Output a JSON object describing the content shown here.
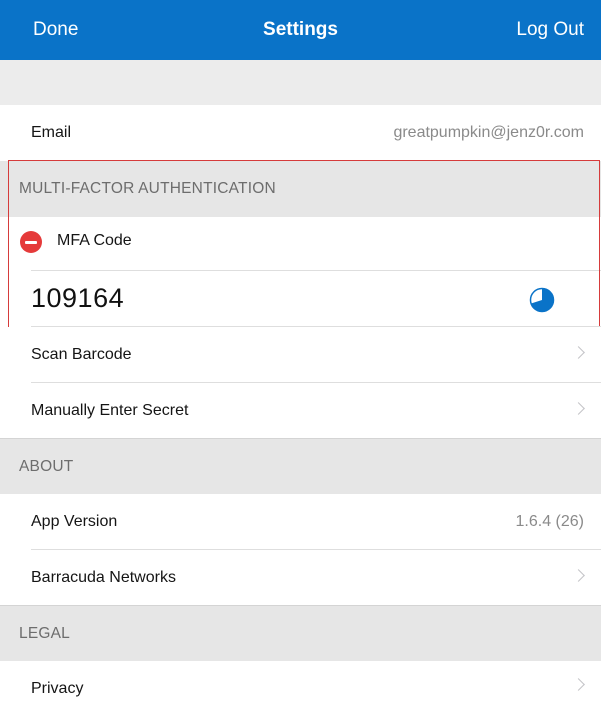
{
  "navbar": {
    "left_label": "Done",
    "title": "Settings",
    "right_label": "Log Out"
  },
  "account": {
    "email_label": "Email",
    "email_value": "greatpumpkin@jenz0r.com"
  },
  "mfa": {
    "section_header": "MULTI-FACTOR AUTHENTICATION",
    "code_label": "MFA Code",
    "code_value": "109164",
    "timer_remaining_fraction": 0.7,
    "scan_barcode_label": "Scan Barcode",
    "manual_secret_label": "Manually Enter Secret"
  },
  "about": {
    "section_header": "ABOUT",
    "app_version_label": "App Version",
    "app_version_value": "1.6.4 (26)",
    "company_label": "Barracuda Networks"
  },
  "legal": {
    "section_header": "LEGAL",
    "privacy_label": "Privacy"
  },
  "colors": {
    "navbar": "#0a73c8",
    "accent_blue": "#0a73c8",
    "delete_red": "#e53a3a",
    "highlight_border": "#d63b3b"
  },
  "icons": {
    "delete": "minus-circle-icon",
    "timer": "countdown-pie-icon",
    "disclosure": "chevron-right-icon"
  }
}
